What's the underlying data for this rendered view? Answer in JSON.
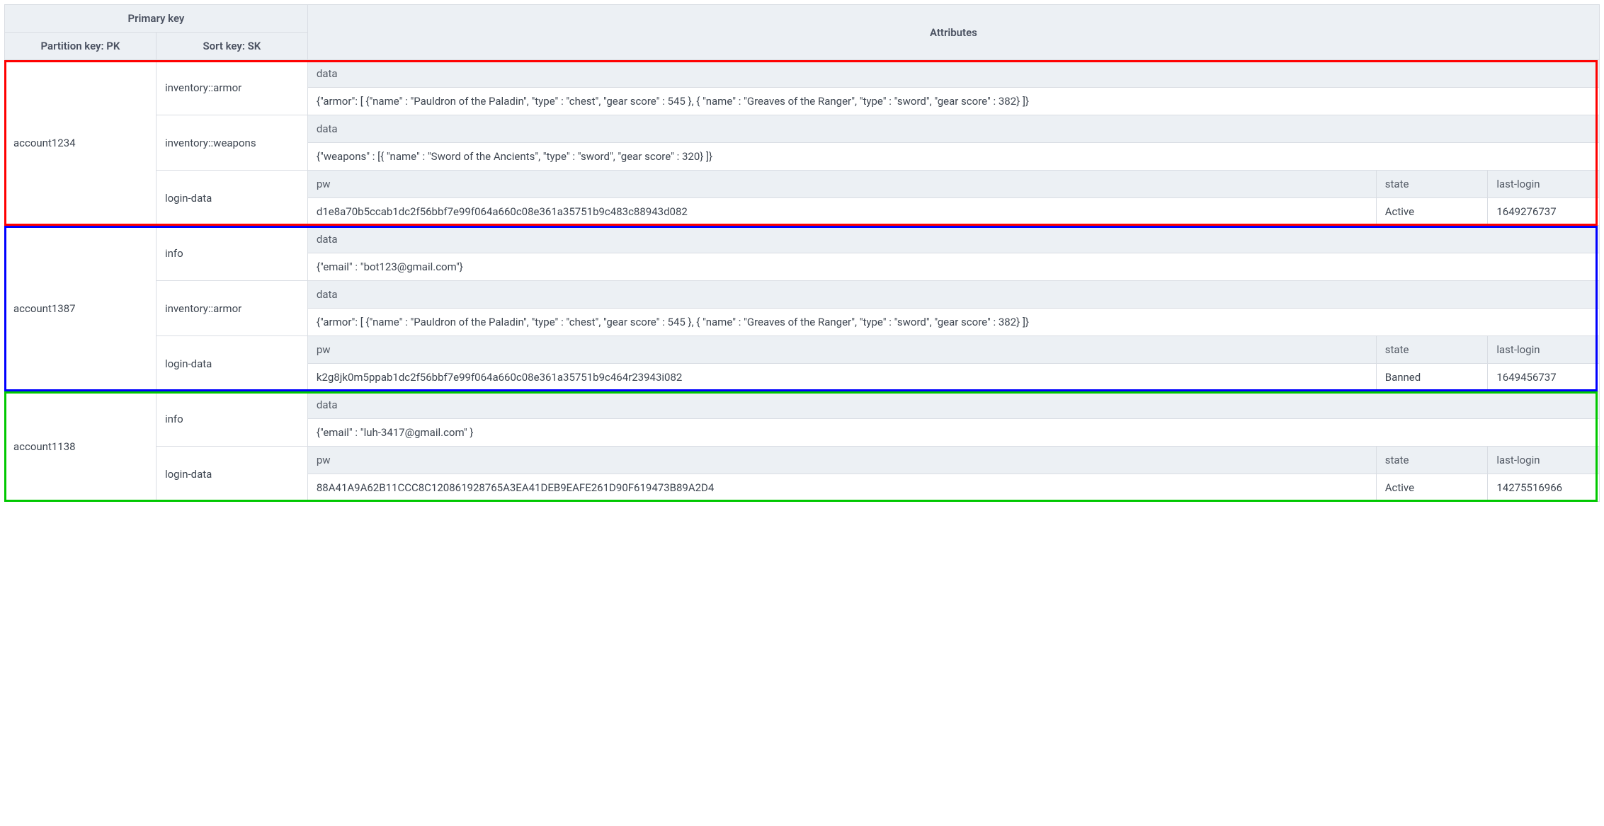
{
  "header": {
    "primary_key": "Primary key",
    "attributes": "Attributes",
    "pk": "Partition key: PK",
    "sk": "Sort key: SK"
  },
  "labels": {
    "data": "data",
    "pw": "pw",
    "state": "state",
    "last_login": "last-login"
  },
  "rows": [
    {
      "pk": "account1234",
      "color": "#ff0000",
      "items": [
        {
          "sk": "inventory::armor",
          "cols": [
            {
              "label_key": "data",
              "value": "{\"armor\": [ {\"name\" : \"Pauldron of the Paladin\", \"type\" : \"chest\", \"gear score\" : 545 }, { \"name\" : \"Greaves of the Ranger\", \"type\" : \"sword\", \"gear score\" : 382} ]}",
              "span": 3
            }
          ]
        },
        {
          "sk": "inventory::weapons",
          "cols": [
            {
              "label_key": "data",
              "value": "{\"weapons\" : [{ \"name\" : \"Sword of the Ancients\", \"type\" : \"sword\", \"gear score\" : 320} ]}",
              "span": 3
            }
          ]
        },
        {
          "sk": "login-data",
          "cols": [
            {
              "label_key": "pw",
              "value": "d1e8a70b5ccab1dc2f56bbf7e99f064a660c08e361a35751b9c483c88943d082",
              "span": 1
            },
            {
              "label_key": "state",
              "value": "Active",
              "span": 1
            },
            {
              "label_key": "last_login",
              "value": "1649276737",
              "span": 1
            }
          ]
        }
      ]
    },
    {
      "pk": "account1387",
      "color": "#0000ff",
      "items": [
        {
          "sk": "info",
          "cols": [
            {
              "label_key": "data",
              "value": "{\"email\" : \"bot123@gmail.com\"}",
              "span": 3
            }
          ]
        },
        {
          "sk": "inventory::armor",
          "cols": [
            {
              "label_key": "data",
              "value": "{\"armor\": [ {\"name\" : \"Pauldron of the Paladin\", \"type\" : \"chest\", \"gear score\" : 545 }, { \"name\" : \"Greaves of the Ranger\", \"type\" : \"sword\", \"gear score\" : 382} ]}",
              "span": 3
            }
          ]
        },
        {
          "sk": "login-data",
          "cols": [
            {
              "label_key": "pw",
              "value": "k2g8jk0m5ppab1dc2f56bbf7e99f064a660c08e361a35751b9c464r23943i082",
              "span": 1
            },
            {
              "label_key": "state",
              "value": "Banned",
              "span": 1
            },
            {
              "label_key": "last_login",
              "value": "1649456737",
              "span": 1
            }
          ]
        }
      ]
    },
    {
      "pk": "account1138",
      "color": "#00c800",
      "items": [
        {
          "sk": "info",
          "cols": [
            {
              "label_key": "data",
              "value": "{\"email\" : \"luh-3417@gmail.com\" }",
              "span": 3
            }
          ]
        },
        {
          "sk": "login-data",
          "cols": [
            {
              "label_key": "pw",
              "value": "88A41A9A62B11CCC8C120861928765A3EA41DEB9EAFE261D90F619473B89A2D4",
              "span": 1
            },
            {
              "label_key": "state",
              "value": "Active",
              "span": 1
            },
            {
              "label_key": "last_login",
              "value": "14275516966",
              "span": 1
            }
          ]
        }
      ]
    }
  ]
}
